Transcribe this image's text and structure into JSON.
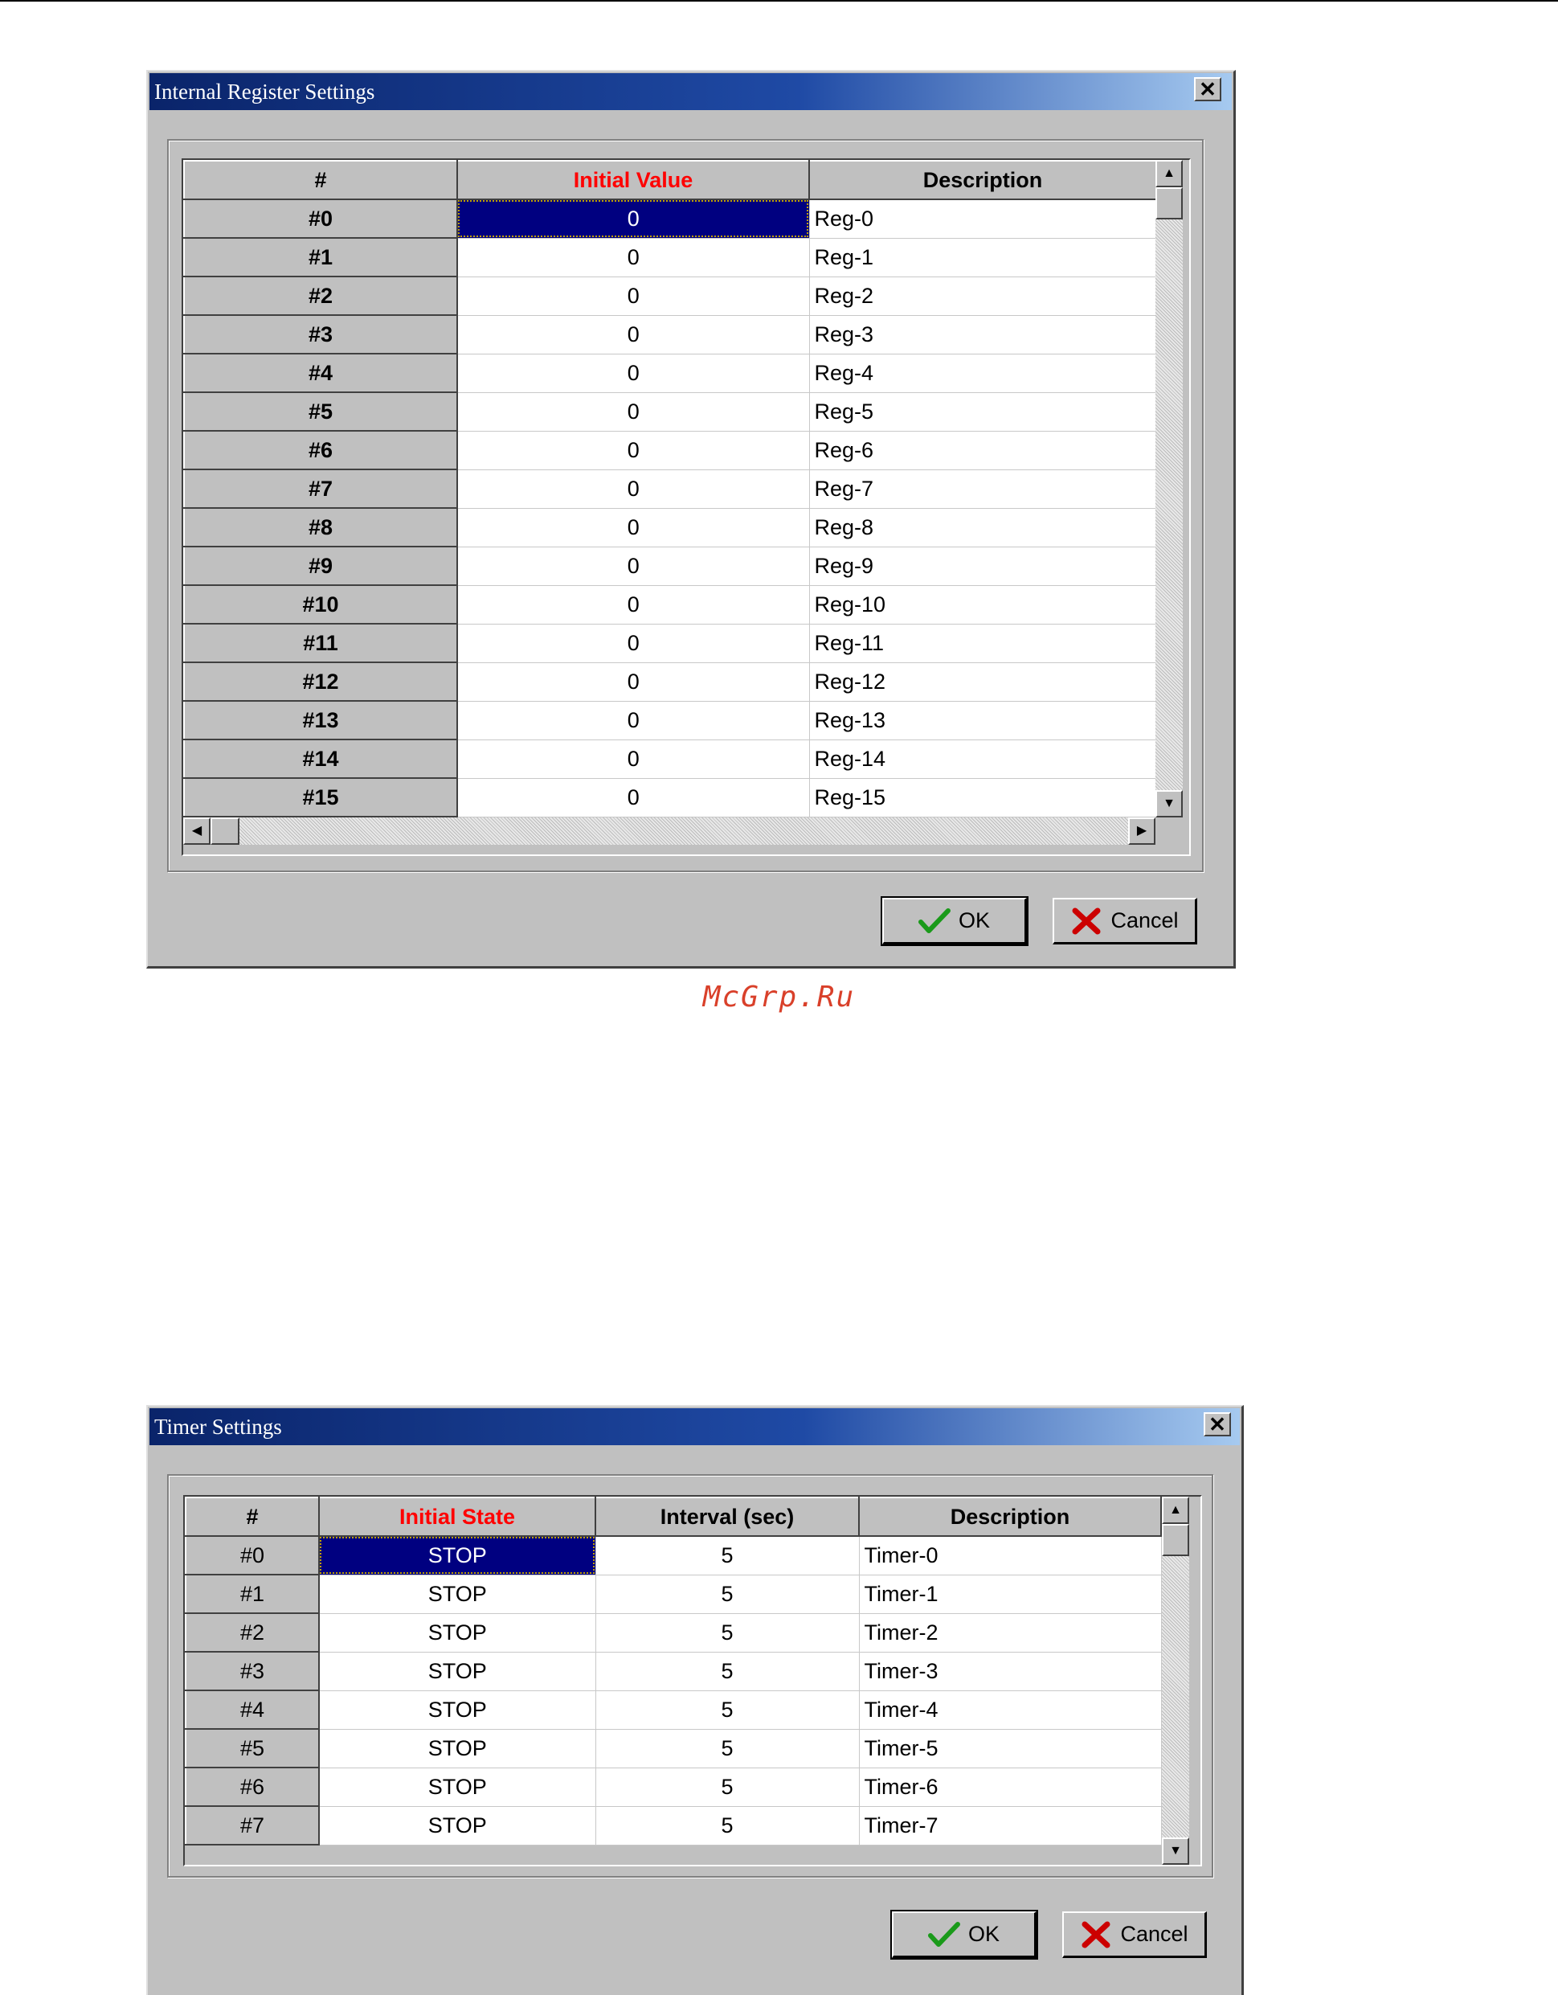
{
  "watermark": "McGrp.Ru",
  "register_dialog": {
    "title": "Internal Register Settings",
    "close_glyph": "✕",
    "columns": [
      "#",
      "Initial Value",
      "Description"
    ],
    "rows": [
      {
        "id": "#0",
        "value": "0",
        "desc": "Reg-0"
      },
      {
        "id": "#1",
        "value": "0",
        "desc": "Reg-1"
      },
      {
        "id": "#2",
        "value": "0",
        "desc": "Reg-2"
      },
      {
        "id": "#3",
        "value": "0",
        "desc": "Reg-3"
      },
      {
        "id": "#4",
        "value": "0",
        "desc": "Reg-4"
      },
      {
        "id": "#5",
        "value": "0",
        "desc": "Reg-5"
      },
      {
        "id": "#6",
        "value": "0",
        "desc": "Reg-6"
      },
      {
        "id": "#7",
        "value": "0",
        "desc": "Reg-7"
      },
      {
        "id": "#8",
        "value": "0",
        "desc": "Reg-8"
      },
      {
        "id": "#9",
        "value": "0",
        "desc": "Reg-9"
      },
      {
        "id": "#10",
        "value": "0",
        "desc": "Reg-10"
      },
      {
        "id": "#11",
        "value": "0",
        "desc": "Reg-11"
      },
      {
        "id": "#12",
        "value": "0",
        "desc": "Reg-12"
      },
      {
        "id": "#13",
        "value": "0",
        "desc": "Reg-13"
      },
      {
        "id": "#14",
        "value": "0",
        "desc": "Reg-14"
      },
      {
        "id": "#15",
        "value": "0",
        "desc": "Reg-15"
      }
    ],
    "ok_label": "OK",
    "cancel_label": "Cancel"
  },
  "timer_dialog": {
    "title": "Timer Settings",
    "close_glyph": "✕",
    "columns": [
      "#",
      "Initial State",
      "Interval (sec)",
      "Description"
    ],
    "rows": [
      {
        "id": "#0",
        "state": "STOP",
        "interval": "5",
        "desc": "Timer-0"
      },
      {
        "id": "#1",
        "state": "STOP",
        "interval": "5",
        "desc": "Timer-1"
      },
      {
        "id": "#2",
        "state": "STOP",
        "interval": "5",
        "desc": "Timer-2"
      },
      {
        "id": "#3",
        "state": "STOP",
        "interval": "5",
        "desc": "Timer-3"
      },
      {
        "id": "#4",
        "state": "STOP",
        "interval": "5",
        "desc": "Timer-4"
      },
      {
        "id": "#5",
        "state": "STOP",
        "interval": "5",
        "desc": "Timer-5"
      },
      {
        "id": "#6",
        "state": "STOP",
        "interval": "5",
        "desc": "Timer-6"
      },
      {
        "id": "#7",
        "state": "STOP",
        "interval": "5",
        "desc": "Timer-7"
      }
    ],
    "ok_label": "OK",
    "cancel_label": "Cancel"
  },
  "icons": {
    "ok": "checkmark-icon",
    "cancel": "x-mark-icon",
    "scroll_up": "▲",
    "scroll_down": "▼",
    "scroll_left": "◀",
    "scroll_right": "▶"
  },
  "colors": {
    "title_bar": "#0a246a",
    "selection": "#000080",
    "highlight_header": "#ff0000",
    "ok_check": "#1a9a1a",
    "cancel_x": "#cc0000",
    "watermark": "#d9402a"
  }
}
